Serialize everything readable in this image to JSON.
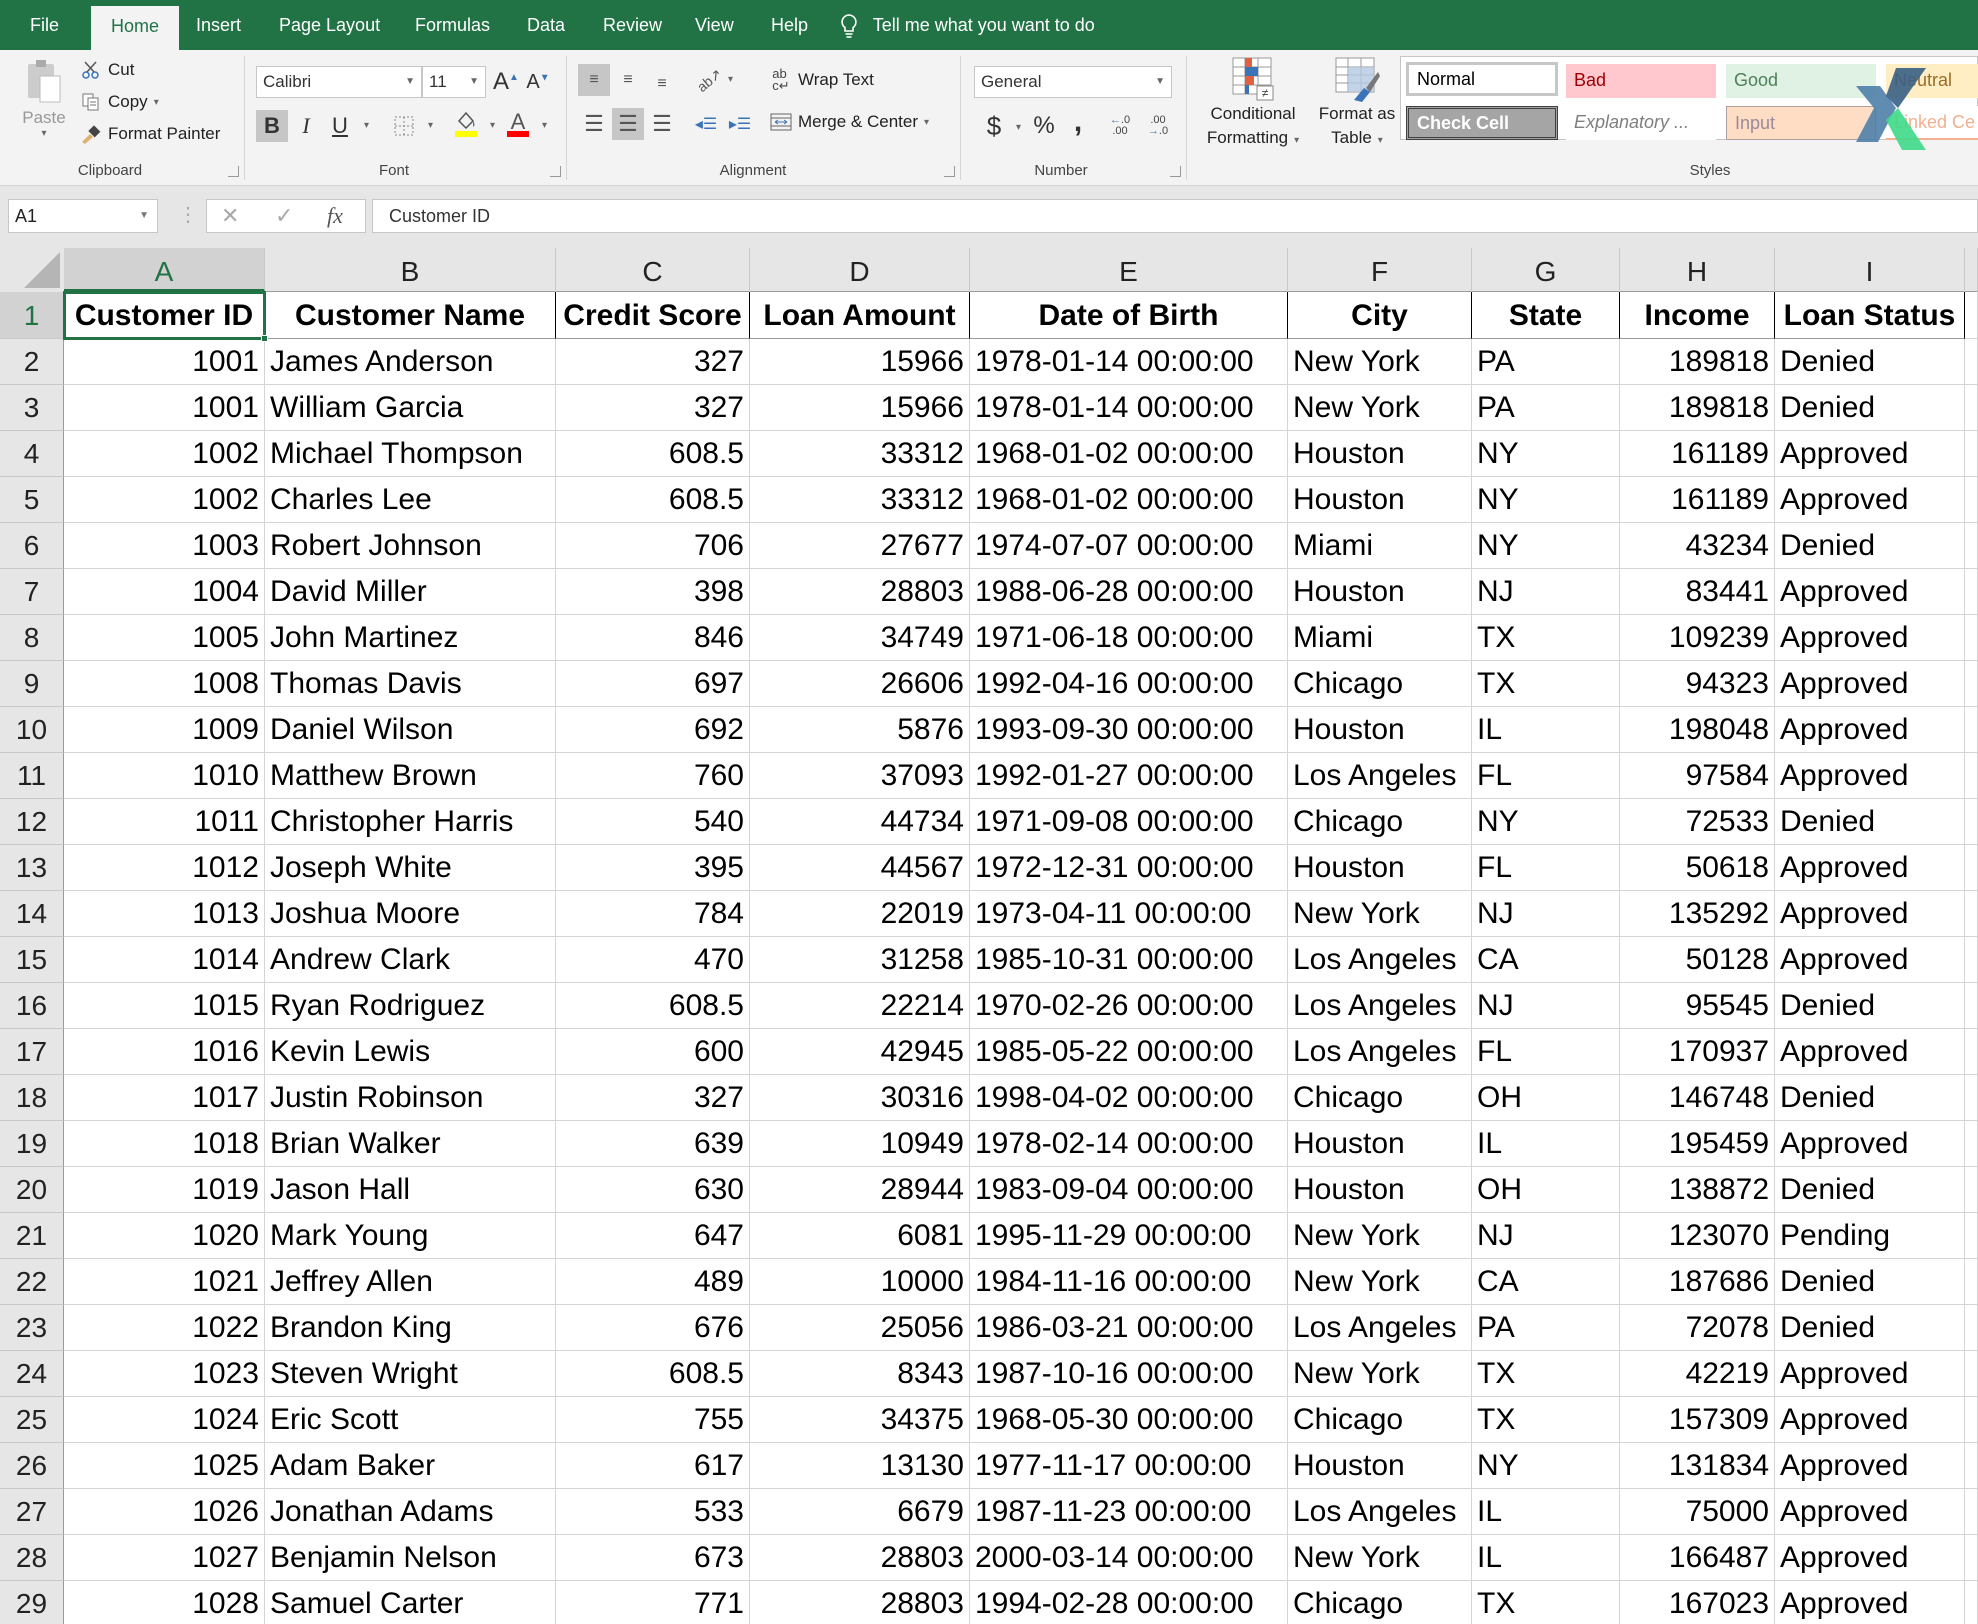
{
  "tabs": [
    "File",
    "Home",
    "Insert",
    "Page Layout",
    "Formulas",
    "Data",
    "Review",
    "View",
    "Help"
  ],
  "active_tab": "Home",
  "tell_me": "Tell me what you want to do",
  "clipboard": {
    "label": "Clipboard",
    "paste": "Paste",
    "cut": "Cut",
    "copy": "Copy",
    "format_painter": "Format Painter"
  },
  "font": {
    "label": "Font",
    "name": "Calibri",
    "size": "11",
    "bold": "B",
    "italic": "I",
    "underline": "U",
    "highlight_color": "#ffff00",
    "font_color": "#ff0000"
  },
  "alignment": {
    "label": "Alignment",
    "wrap_text": "Wrap Text",
    "merge_center": "Merge & Center"
  },
  "number": {
    "label": "Number",
    "format": "General",
    "currency": "$",
    "percent": "%",
    "comma": ",",
    "inc_decimal": "←.0 .00",
    "dec_decimal": ".00 →.0"
  },
  "styles": {
    "label": "Styles",
    "conditional_formatting": [
      "Conditional",
      "Formatting"
    ],
    "format_as_table": [
      "Format as",
      "Table"
    ],
    "gallery": [
      {
        "name": "Normal"
      },
      {
        "name": "Bad"
      },
      {
        "name": "Good"
      },
      {
        "name": "Neutral"
      },
      {
        "name": "Check Cell"
      },
      {
        "name": "Explanatory ..."
      },
      {
        "name": "Input"
      },
      {
        "name": "Linked Ce"
      }
    ]
  },
  "formula_bar": {
    "name_box": "A1",
    "cancel": "✕",
    "enter": "✓",
    "fx": "fx",
    "value": "Customer ID"
  },
  "sheet": {
    "active_cell": "A1",
    "column_letters": [
      "A",
      "B",
      "C",
      "D",
      "E",
      "F",
      "G",
      "H",
      "I"
    ],
    "headers": [
      "Customer ID",
      "Customer Name",
      "Credit Score",
      "Loan Amount",
      "Date of Birth",
      "City",
      "State",
      "Income",
      "Loan Status"
    ],
    "rows": [
      [
        "1001",
        "James Anderson",
        "327",
        "15966",
        "1978-01-14 00:00:00",
        "New York",
        "PA",
        "189818",
        "Denied"
      ],
      [
        "1001",
        "William Garcia",
        "327",
        "15966",
        "1978-01-14 00:00:00",
        "New York",
        "PA",
        "189818",
        "Denied"
      ],
      [
        "1002",
        "Michael Thompson",
        "608.5",
        "33312",
        "1968-01-02 00:00:00",
        "Houston",
        "NY",
        "161189",
        "Approved"
      ],
      [
        "1002",
        "Charles Lee",
        "608.5",
        "33312",
        "1968-01-02 00:00:00",
        "Houston",
        "NY",
        "161189",
        "Approved"
      ],
      [
        "1003",
        "Robert Johnson",
        "706",
        "27677",
        "1974-07-07 00:00:00",
        "Miami",
        "NY",
        "43234",
        "Denied"
      ],
      [
        "1004",
        "David Miller",
        "398",
        "28803",
        "1988-06-28 00:00:00",
        "Houston",
        "NJ",
        "83441",
        "Approved"
      ],
      [
        "1005",
        "John Martinez",
        "846",
        "34749",
        "1971-06-18 00:00:00",
        "Miami",
        "TX",
        "109239",
        "Approved"
      ],
      [
        "1008",
        "Thomas Davis",
        "697",
        "26606",
        "1992-04-16 00:00:00",
        "Chicago",
        "TX",
        "94323",
        "Approved"
      ],
      [
        "1009",
        "Daniel Wilson",
        "692",
        "5876",
        "1993-09-30 00:00:00",
        "Houston",
        "IL",
        "198048",
        "Approved"
      ],
      [
        "1010",
        "Matthew Brown",
        "760",
        "37093",
        "1992-01-27 00:00:00",
        "Los Angeles",
        "FL",
        "97584",
        "Approved"
      ],
      [
        "1011",
        "Christopher Harris",
        "540",
        "44734",
        "1971-09-08 00:00:00",
        "Chicago",
        "NY",
        "72533",
        "Denied"
      ],
      [
        "1012",
        "Joseph White",
        "395",
        "44567",
        "1972-12-31 00:00:00",
        "Houston",
        "FL",
        "50618",
        "Approved"
      ],
      [
        "1013",
        "Joshua Moore",
        "784",
        "22019",
        "1973-04-11 00:00:00",
        "New York",
        "NJ",
        "135292",
        "Approved"
      ],
      [
        "1014",
        "Andrew Clark",
        "470",
        "31258",
        "1985-10-31 00:00:00",
        "Los Angeles",
        "CA",
        "50128",
        "Approved"
      ],
      [
        "1015",
        "Ryan Rodriguez",
        "608.5",
        "22214",
        "1970-02-26 00:00:00",
        "Los Angeles",
        "NJ",
        "95545",
        "Denied"
      ],
      [
        "1016",
        "Kevin Lewis",
        "600",
        "42945",
        "1985-05-22 00:00:00",
        "Los Angeles",
        "FL",
        "170937",
        "Approved"
      ],
      [
        "1017",
        "Justin Robinson",
        "327",
        "30316",
        "1998-04-02 00:00:00",
        "Chicago",
        "OH",
        "146748",
        "Denied"
      ],
      [
        "1018",
        "Brian Walker",
        "639",
        "10949",
        "1978-02-14 00:00:00",
        "Houston",
        "IL",
        "195459",
        "Approved"
      ],
      [
        "1019",
        "Jason Hall",
        "630",
        "28944",
        "1983-09-04 00:00:00",
        "Houston",
        "OH",
        "138872",
        "Denied"
      ],
      [
        "1020",
        "Mark Young",
        "647",
        "6081",
        "1995-11-29 00:00:00",
        "New York",
        "NJ",
        "123070",
        "Pending"
      ],
      [
        "1021",
        "Jeffrey Allen",
        "489",
        "10000",
        "1984-11-16 00:00:00",
        "New York",
        "CA",
        "187686",
        "Denied"
      ],
      [
        "1022",
        "Brandon King",
        "676",
        "25056",
        "1986-03-21 00:00:00",
        "Los Angeles",
        "PA",
        "72078",
        "Denied"
      ],
      [
        "1023",
        "Steven Wright",
        "608.5",
        "8343",
        "1987-10-16 00:00:00",
        "New York",
        "TX",
        "42219",
        "Approved"
      ],
      [
        "1024",
        "Eric Scott",
        "755",
        "34375",
        "1968-05-30 00:00:00",
        "Chicago",
        "TX",
        "157309",
        "Approved"
      ],
      [
        "1025",
        "Adam Baker",
        "617",
        "13130",
        "1977-11-17 00:00:00",
        "Houston",
        "NY",
        "131834",
        "Approved"
      ],
      [
        "1026",
        "Jonathan Adams",
        "533",
        "6679",
        "1987-11-23 00:00:00",
        "Los Angeles",
        "IL",
        "75000",
        "Approved"
      ],
      [
        "1027",
        "Benjamin Nelson",
        "673",
        "28803",
        "2000-03-14 00:00:00",
        "New York",
        "IL",
        "166487",
        "Approved"
      ],
      [
        "1028",
        "Samuel Carter",
        "771",
        "28803",
        "1994-02-28 00:00:00",
        "Chicago",
        "TX",
        "167023",
        "Approved"
      ]
    ],
    "numeric_columns": [
      0,
      2,
      3,
      7
    ]
  }
}
